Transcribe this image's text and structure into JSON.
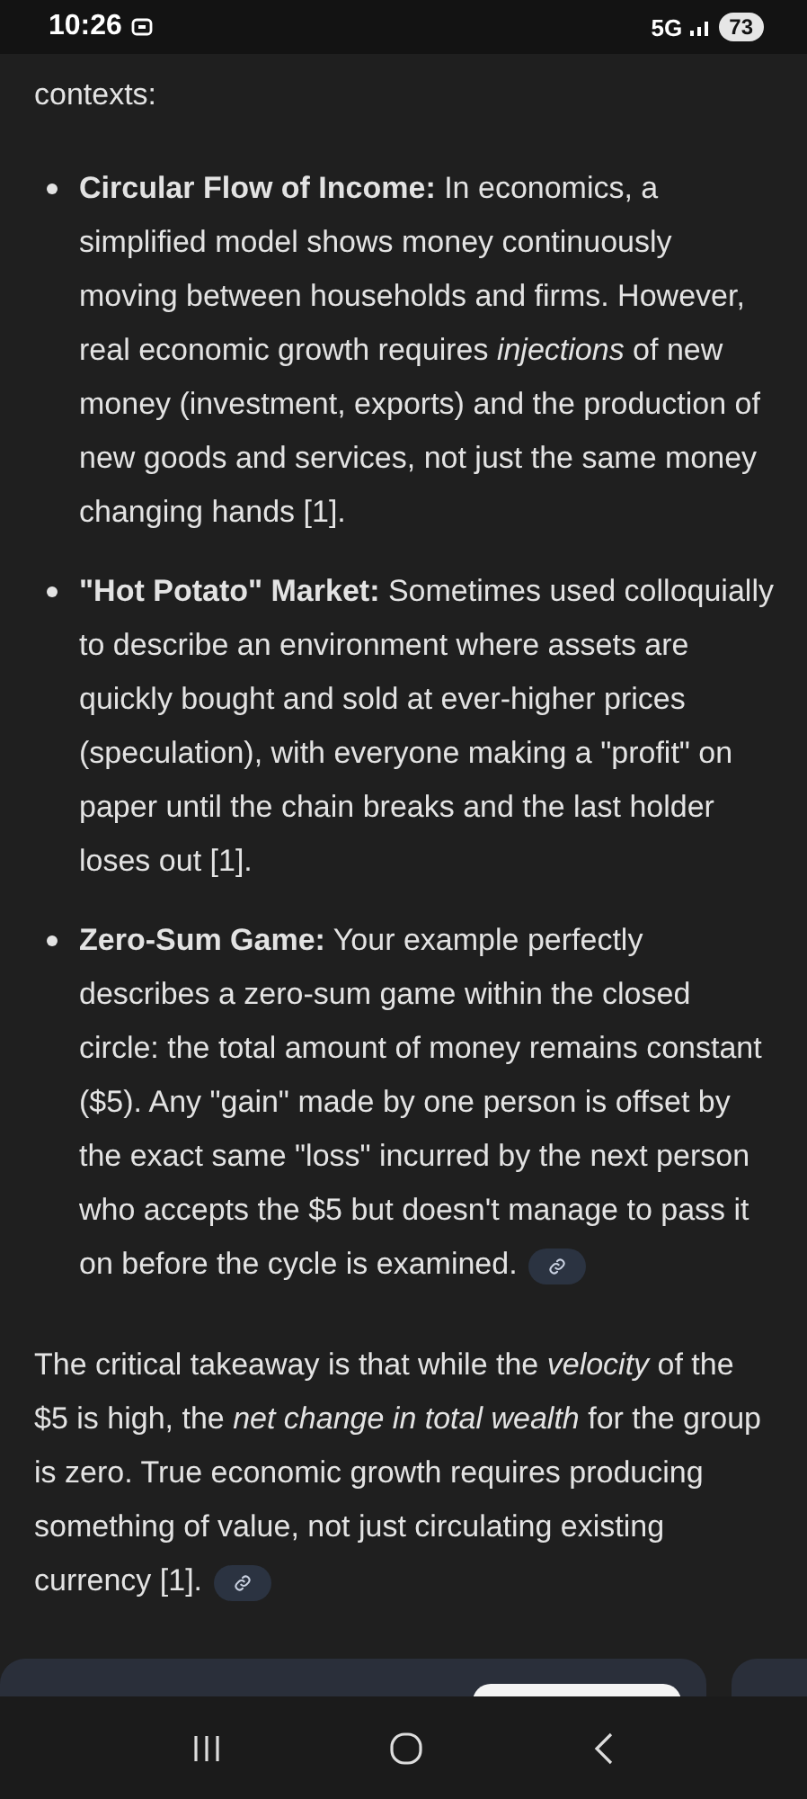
{
  "status_bar": {
    "time": "10:26",
    "network": "5G",
    "battery": "73"
  },
  "intro": "contexts:",
  "bullets": [
    {
      "term": "Circular Flow of Income:",
      "body": "In economics, a simplified model shows money continuously moving between households and firms. However, real economic growth requires *injections* of new money (investment, exports) and the production of new goods and services, not just the same money changing hands [1].",
      "has_link": false
    },
    {
      "term": "\"Hot Potato\" Market:",
      "body": "Sometimes used colloquially to describe an environment where assets are quickly bought and sold at ever-higher prices (speculation), with everyone making a \"profit\" on paper until the chain breaks and the last holder loses out [1].",
      "has_link": false
    },
    {
      "term": "Zero-Sum Game:",
      "body": "Your example perfectly describes a zero-sum game within the closed circle: the total amount of money remains constant ($5). Any \"gain\" made by one person is offset by the exact same \"loss\" incurred by the next person who accepts the $5 but doesn't manage to pass it on before the cycle is examined.",
      "has_link": true
    }
  ],
  "conclusion": {
    "text": "The critical takeaway is that while the *velocity* of the $5 is high, the *net change in total wealth* for the group is zero. True economic growth requires producing something of value, not just circulating existing currency [1].",
    "has_link": true
  },
  "cards": [
    {
      "has_button": true
    },
    {
      "has_button": false
    }
  ]
}
